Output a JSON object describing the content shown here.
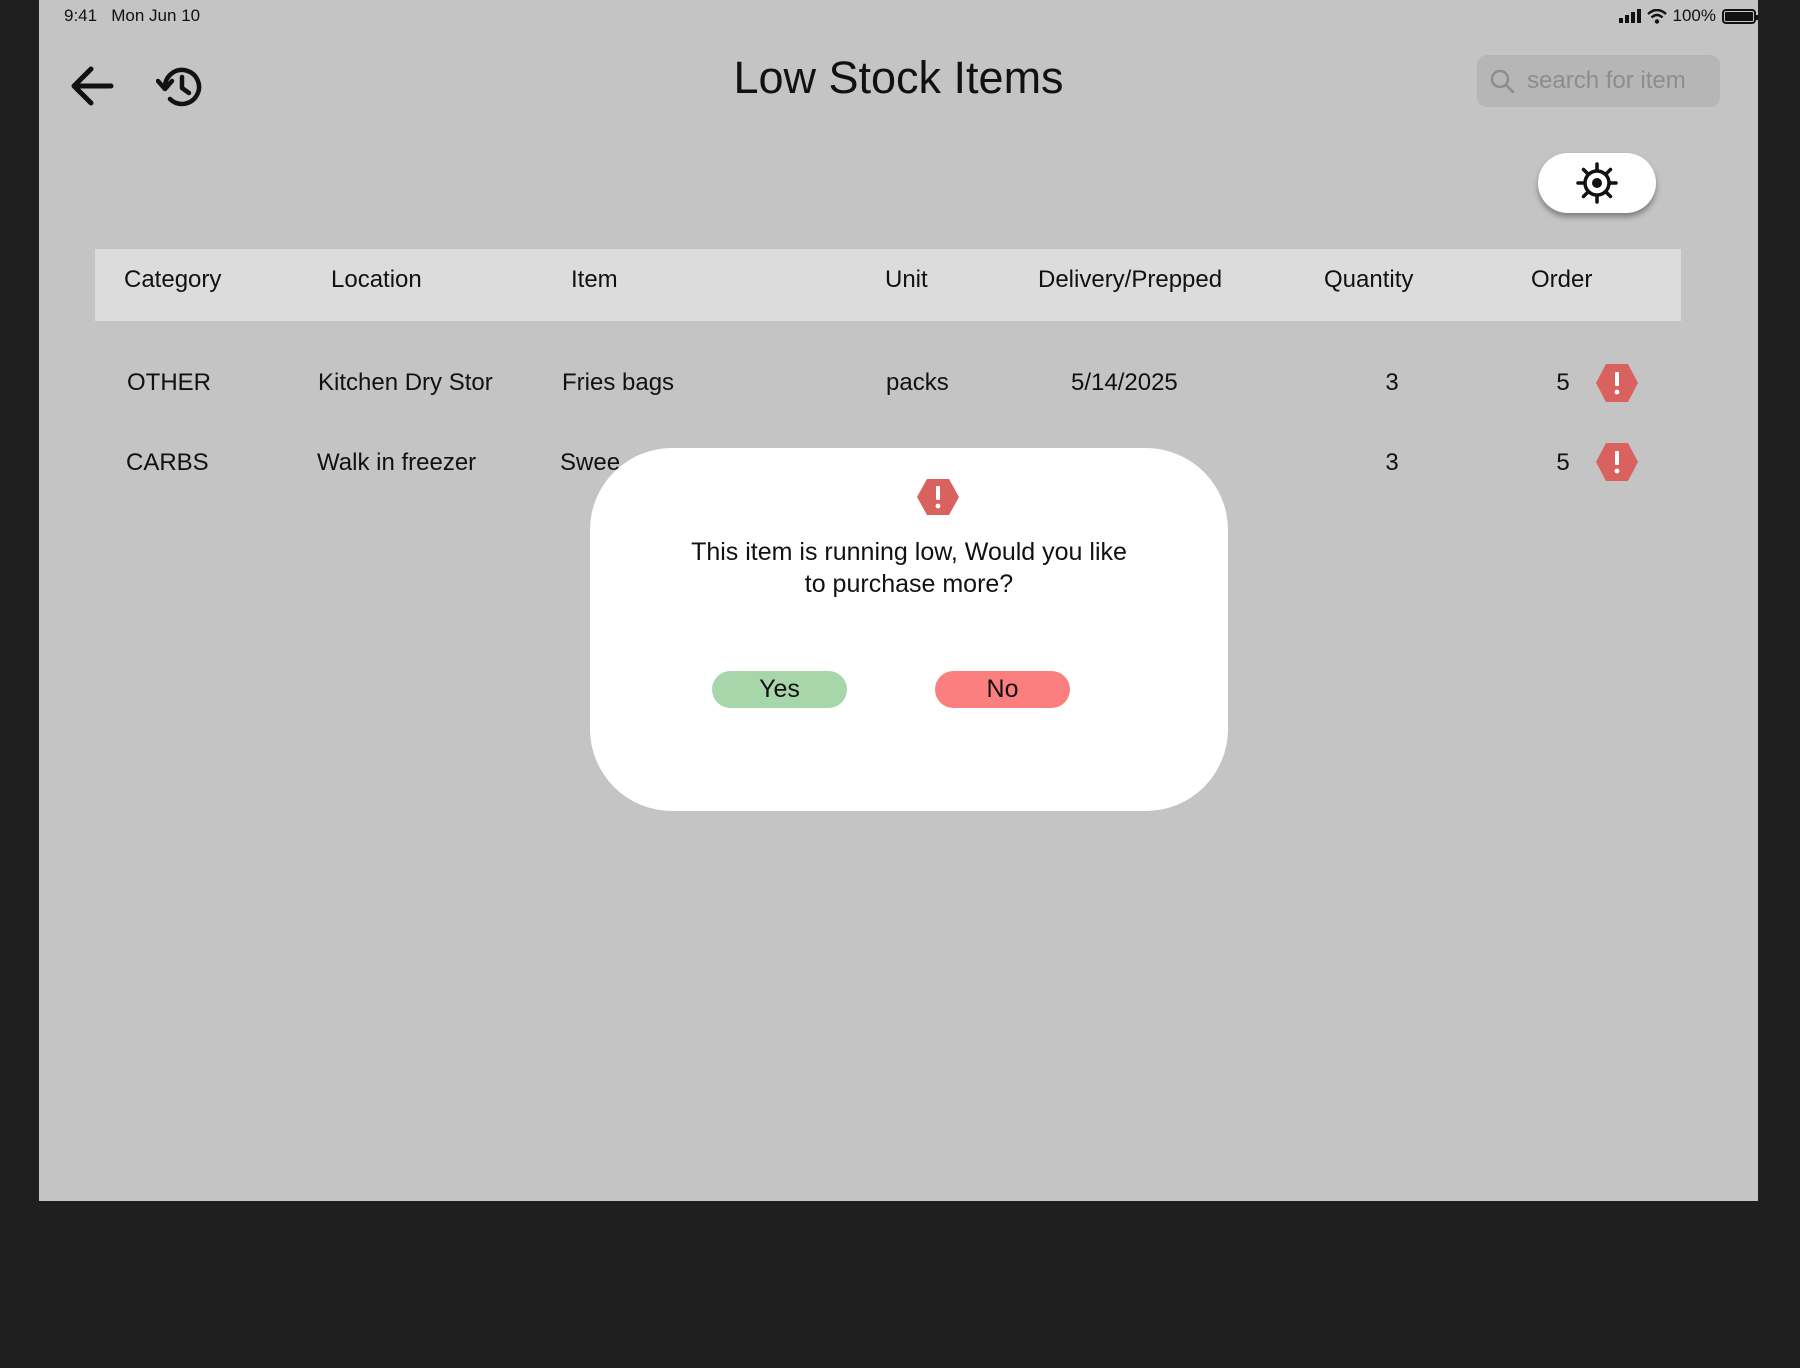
{
  "status_bar": {
    "time": "9:41",
    "date": "Mon Jun 10",
    "battery": "100%"
  },
  "header": {
    "title": "Low Stock Items",
    "search_placeholder": "search for item",
    "back_icon": "arrow-left-icon",
    "history_icon": "history-icon",
    "settings_icon": "gear-icon"
  },
  "table": {
    "columns": [
      "Category",
      "Location",
      "Item",
      "Unit",
      "Delivery/Prepped",
      "Quantity",
      "Order"
    ],
    "rows": [
      {
        "category": "OTHER",
        "location": "Kitchen Dry Stor",
        "item": "Fries bags",
        "unit": "packs",
        "date": "5/14/2025",
        "quantity": "3",
        "order": "5"
      },
      {
        "category": "CARBS",
        "location": "Walk in freezer",
        "item": "Swee",
        "quantity": "3",
        "order": "5"
      }
    ]
  },
  "modal": {
    "icon": "alert-hexagon-icon",
    "message_line1": "This item is running low, Would you like",
    "message_line2": "to purchase more?",
    "yes_label": "Yes",
    "no_label": "No"
  },
  "colors": {
    "alert": "#d9625f",
    "yes": "#a8d6ab",
    "no": "#fb7f7f",
    "overlay_bg": "#c4c4c4",
    "header_row": "#dcdcdc"
  }
}
